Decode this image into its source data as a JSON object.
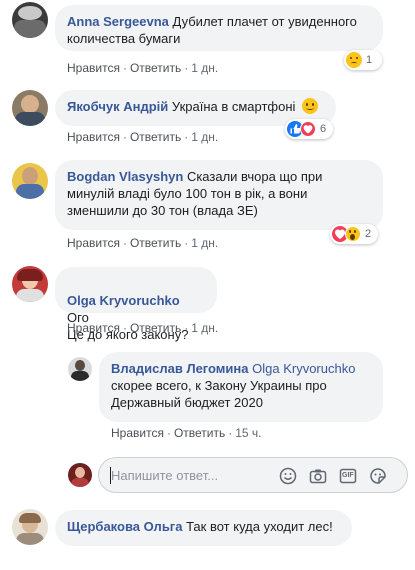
{
  "comments": [
    {
      "author": "Anna Sergeevna",
      "text": "Дубилет плачет от увиденного количества бумаги",
      "like": "Нравится",
      "reply": "Ответить",
      "time": "1 дн.",
      "reaction_count": "1",
      "reaction_icons": [
        "sad-icon"
      ]
    },
    {
      "author": "Якобчук Андрій",
      "text": "Україна в смартфоні",
      "like": "Нравится",
      "reply": "Ответить",
      "time": "1 дн.",
      "reaction_count": "6",
      "reaction_icons": [
        "like-icon",
        "love-icon"
      ]
    },
    {
      "author": "Bogdan Vlasyshyn",
      "text": "Сказали вчора що при минулій владі було 100 тон в рік, а вони зменшили до 30 тон (влада ЗЕ)",
      "like": "Нравится",
      "reply": "Ответить",
      "time": "1 дн.",
      "reaction_count": "2",
      "reaction_icons": [
        "love-icon",
        "wow-icon"
      ]
    },
    {
      "author": "Olga Kryvoruchko",
      "text": "Ого\nЦе до якого закону?",
      "like": "Нравится",
      "reply": "Ответить",
      "time": "1 дн."
    }
  ],
  "reply": {
    "author": "Владислав Легомина",
    "tagged": "Olga Kryvoruchko",
    "text": "скорее всего, к Закону Украины про Державный бюджет 2020",
    "like": "Нравится",
    "reply": "Ответить",
    "time": "15 ч."
  },
  "reply_input": {
    "placeholder": "Напишите ответ...",
    "tools": [
      "emoji-icon",
      "camera-icon",
      "gif-icon",
      "sticker-icon"
    ],
    "gif_label": "GIF"
  },
  "last_comment": {
    "author": "Щербакова Ольга",
    "text": "Так вот куда уходит лес!"
  },
  "colors": {
    "author": "#385898",
    "bubble": "#f2f3f5",
    "meta": "#606770",
    "like_blue": "#1877f2",
    "love_red": "#f33e58",
    "haha_yellow": "#fcc419"
  }
}
